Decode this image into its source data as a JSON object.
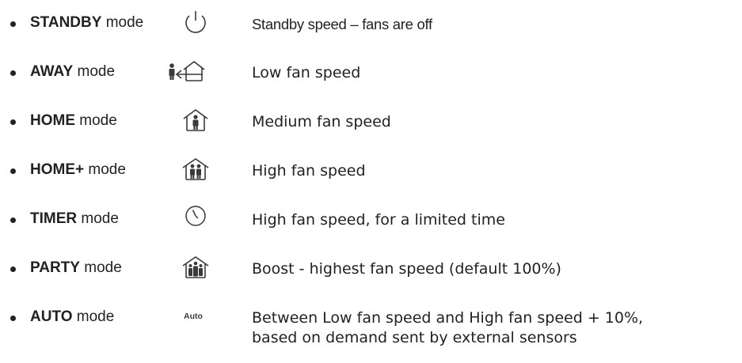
{
  "modes": [
    {
      "name": "STANDBY",
      "suffix": " mode",
      "icon": "power-icon",
      "description": "Standby speed – fans are off"
    },
    {
      "name": "AWAY",
      "suffix": " mode",
      "icon": "person-leaving-house-icon",
      "description": "Low fan speed"
    },
    {
      "name": "HOME",
      "suffix": " mode",
      "icon": "house-one-person-icon",
      "description": "Medium fan speed"
    },
    {
      "name": "HOME+",
      "suffix": " mode",
      "icon": "house-two-people-icon",
      "description": "High fan speed"
    },
    {
      "name": "TIMER",
      "suffix": " mode",
      "icon": "clock-icon",
      "description": "High fan speed, for a limited time"
    },
    {
      "name": "PARTY",
      "suffix": " mode",
      "icon": "house-group-icon",
      "description": "Boost - highest fan speed (default 100%)"
    },
    {
      "name": "AUTO",
      "suffix": " mode",
      "icon": "auto-text-icon",
      "icon_text": "Auto",
      "description": "Between Low fan speed and High fan speed + 10%,",
      "description_line2": "based on demand sent by external sensors"
    }
  ],
  "icon_color": "#3a3a3a"
}
